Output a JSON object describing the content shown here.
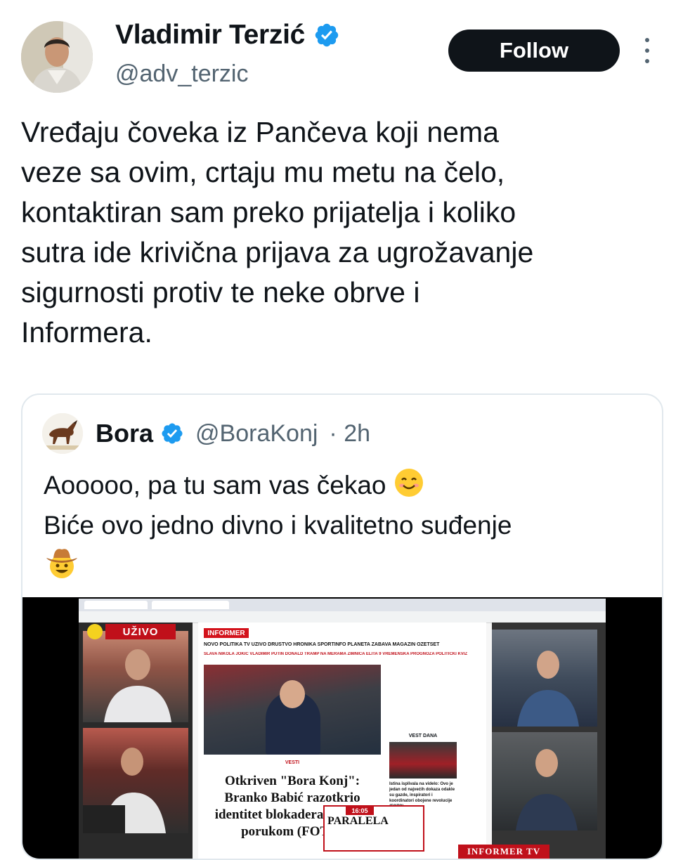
{
  "author": {
    "name": "Vladimir Terzić",
    "handle": "@adv_terzic",
    "verified": true,
    "follow_label": "Follow"
  },
  "tweet": {
    "text": "Vređaju čoveka iz Pančeva koji nema\nveze sa ovim, crtaju mu metu na čelo,\nkontaktiran sam preko prijatelja i koliko\nsutra ide krivična prijava za ugrožavanje\nsigurnosti protiv te neke obrve i\nInformera."
  },
  "quoted_tweet": {
    "name": "Bora",
    "handle": "@BoraKonj",
    "time": "· 2h",
    "verified": true,
    "line1": "Aooooo, pa tu sam vas čekao",
    "line2": "Biće ovo jedno divno i kvalitetno suđenje",
    "emoji1": "smiling-face-icon",
    "emoji2": "cowboy-face-icon"
  },
  "media": {
    "live_label": "UŽIVO",
    "site_logo": "INFORMER",
    "nav_items": "NOVO  POLITIKA  TV UŽIVO  DRUŠTVO  HRONIKA  SPORTINFO  PLANETA  ZABAVA  MAGAZIN  OZETSET",
    "nav_items2": "SLAVA  NIKOLA JOKIĆ  VLADIMIR PUTIN  DONALD TRAMP  NA MERAMA  ZIMNICA  ELITA 9  VREMENSKA PROGNOZA  POLITIČKI KVIZ",
    "section": "VESTI",
    "headline": "Otkriven \"Bora Konj\": Branko Babić razotkrio identitet blokadera jednom porukom (FOTO)",
    "vest_dana": "VEST DANA",
    "vest_dana_text": "Istina isplivala na videlo: Ovo je jedan od najvećih dokaza odakle su gazde, inspiratori i koordinatori obojene revolucije (FOTO)",
    "show_name": "PARALELA",
    "show_time": "16:05",
    "tv_logo": "INFORMER TV"
  },
  "colors": {
    "verified_blue": "#1d9bf0",
    "text_primary": "#0f1419",
    "text_secondary": "#536471",
    "informer_red": "#c0101a"
  }
}
